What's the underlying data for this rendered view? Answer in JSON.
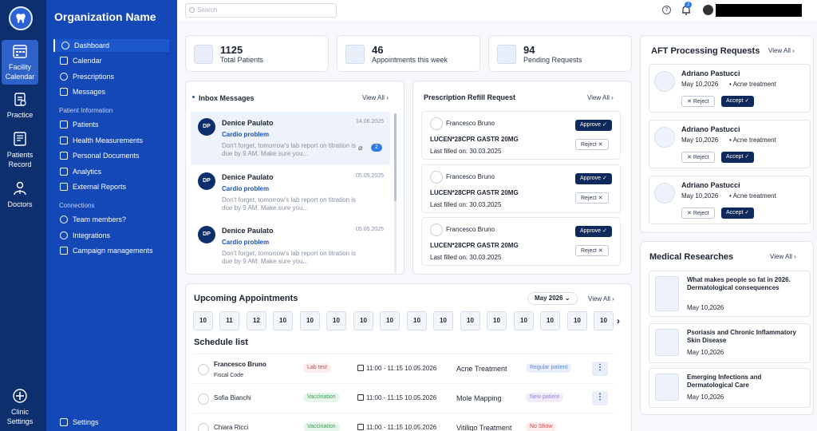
{
  "org_name": "Organization Name",
  "rail": [
    {
      "label": "Facility Calendar",
      "icon": "calendar-grid-icon"
    },
    {
      "label": "Practice",
      "icon": "clipboard-icon"
    },
    {
      "label": "Patients Record",
      "icon": "records-icon"
    },
    {
      "label": "Doctors",
      "icon": "doctor-icon"
    },
    {
      "label": "Clinic Settings",
      "icon": "clinic-settings-icon"
    }
  ],
  "nav": {
    "items_main": [
      "Dashboard",
      "Calendar",
      "Prescriptions",
      "Messages"
    ],
    "section_patient": "Patient Information",
    "items_patient": [
      "Patients",
      "Health Measurements",
      "Personal Documents",
      "Analytics",
      "External Reports"
    ],
    "section_connections": "Connections",
    "items_connections": [
      "Team members?",
      "Integrations",
      "Campaign managements"
    ],
    "settings": "Settings"
  },
  "topbar": {
    "search_placeholder": "Search",
    "help": "?",
    "notifications": "2"
  },
  "stats": [
    {
      "value": "1125",
      "label": "Total Patients"
    },
    {
      "value": "46",
      "label": "Appointments this week"
    },
    {
      "value": "94",
      "label": "Pending Requests"
    }
  ],
  "inbox": {
    "title": "Inbox Messages",
    "view_all": "View All",
    "messages": [
      {
        "initials": "DP",
        "name": "Denice Paulato",
        "date": "14.06.2025",
        "subject": "Cardio problem",
        "text": "Don't forget, tomorrow's lab report on titration is due by 9 AM. Make sure you...",
        "count": "2"
      },
      {
        "initials": "DP",
        "name": "Denice Paulato",
        "date": "05.05.2025",
        "subject": "Cardio problem",
        "text": "Don't forget, tomorrow's lab report on titration is due by 9 AM. Make sure you...",
        "count": ""
      },
      {
        "initials": "DP",
        "name": "Denice Paulato",
        "date": "05.05.2025",
        "subject": "Cardio problem",
        "text": "Don't forget, tomorrow's lab report on titration is due by 9 AM. Make sure you...",
        "count": ""
      }
    ]
  },
  "refill": {
    "title": "Prescription Refill Request",
    "view_all": "View All",
    "approve": "Approve",
    "reject": "Reject",
    "items": [
      {
        "name": "Francesco Bruno",
        "med": "LUCEN*28CPR GASTR 20MG",
        "filled": "Last filled on: 30.03.2025"
      },
      {
        "name": "Francesco Bruno",
        "med": "LUCEN*28CPR GASTR 20MG",
        "filled": "Last filled on: 30.03.2025"
      },
      {
        "name": "Francesco Bruno",
        "med": "LUCEN*28CPR GASTR 20MG",
        "filled": "Last filled on: 30.03.2025"
      }
    ]
  },
  "appointments": {
    "title": "Upcoming Appointments",
    "month": "May 2026",
    "view_all": "View All",
    "days": [
      "10",
      "11",
      "12",
      "10",
      "10",
      "10",
      "10",
      "10",
      "10",
      "10",
      "10",
      "10",
      "10",
      "10",
      "10",
      "10"
    ],
    "schedule_title": "Schedule list",
    "schedule": [
      {
        "name": "Francesco Bruno",
        "sub": "Fiscal Code",
        "tag": "Lab test",
        "time": "11:00 - 11:15 10.05.2026",
        "service": "Acne Treatment",
        "status": "Regular patient"
      },
      {
        "name": "Sofia Bianchi",
        "sub": "",
        "tag": "Vaccination",
        "time": "11:00 - 11:15 10.05.2026",
        "service": "Mole Mapping",
        "status": "New patient"
      },
      {
        "name": "Chiara Ricci",
        "sub": "",
        "tag": "Vaccination",
        "time": "11:00 - 11:15 10.05.2026",
        "service": "Vitiligo Treatment",
        "status": "No Show"
      }
    ]
  },
  "aft": {
    "title": "AFT Processing Requests",
    "view_all": "View All",
    "reject": "Reject",
    "accept": "Accept",
    "items": [
      {
        "name": "Adriano Pastucci",
        "date": "May 10,2026",
        "treatment": "Acne treatment"
      },
      {
        "name": "Adriano Pastucci",
        "date": "May 10,2026",
        "treatment": "Acne treatment"
      },
      {
        "name": "Adriano Pastucci",
        "date": "May 10,2026",
        "treatment": "Acne treatment"
      }
    ]
  },
  "research": {
    "title": "Medical Researches",
    "view_all": "View All",
    "items": [
      {
        "title": "What makes people so fat in 2026. Dermatological consequences",
        "date": "May 10,2026"
      },
      {
        "title": "Psoriasis and Chronic Inflammatory Skin Disease",
        "date": "May 10,2026"
      },
      {
        "title": "Emerging Infections and Dermatological Care",
        "date": "May 10,2026"
      }
    ]
  }
}
